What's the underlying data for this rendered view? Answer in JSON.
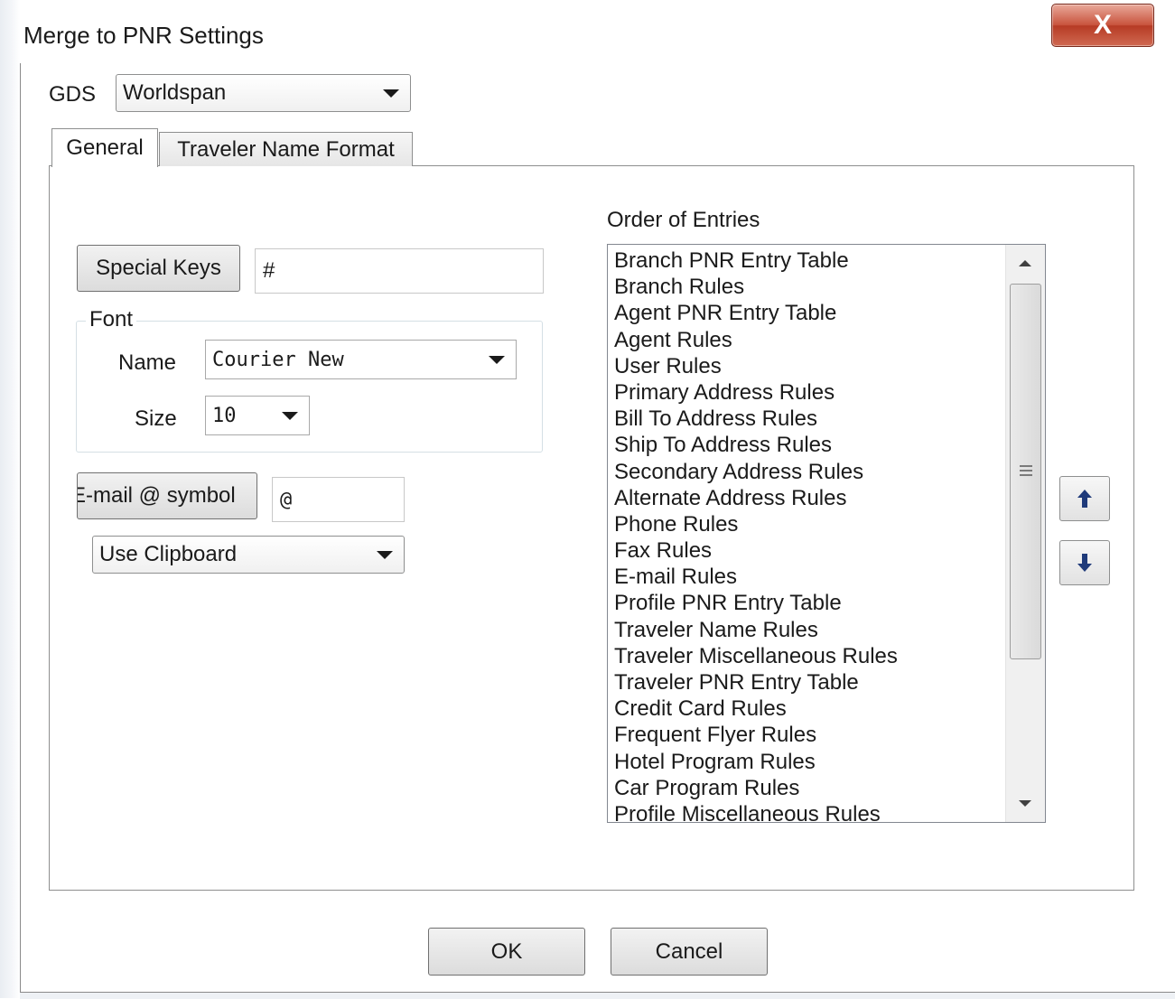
{
  "window": {
    "title": "Merge to PNR Settings",
    "close_label": "X"
  },
  "gds": {
    "label": "GDS",
    "selected": "Worldspan"
  },
  "tabs": [
    {
      "label": "General",
      "active": true
    },
    {
      "label": "Traveler Name Format",
      "active": false
    }
  ],
  "general": {
    "special_keys_button": "Special Keys",
    "special_keys_value": "#",
    "font_group_label": "Font",
    "font_name_label": "Name",
    "font_name_selected": "Courier New",
    "font_size_label": "Size",
    "font_size_selected": "10",
    "email_button": "E-mail @ symbol",
    "email_value": "@",
    "output_selected": "Use Clipboard"
  },
  "order": {
    "label": "Order of Entries",
    "items": [
      "Branch PNR Entry Table",
      "Branch Rules",
      "Agent PNR Entry Table",
      "Agent Rules",
      "User Rules",
      "Primary Address Rules",
      "Bill To Address Rules",
      "Ship To Address Rules",
      "Secondary Address Rules",
      "Alternate Address Rules",
      "Phone Rules",
      "Fax Rules",
      "E-mail Rules",
      "Profile PNR Entry Table",
      "Traveler Name Rules",
      "Traveler Miscellaneous Rules",
      "Traveler PNR Entry Table",
      "Credit Card Rules",
      "Frequent Flyer Rules",
      "Hotel Program Rules",
      "Car Program Rules",
      "Profile Miscellaneous Rules"
    ],
    "move_up_icon": "arrow-up-icon",
    "move_down_icon": "arrow-down-icon"
  },
  "footer": {
    "ok_label": "OK",
    "cancel_label": "Cancel"
  },
  "colors": {
    "close_button": "#c8523c",
    "arrow_icon": "#1f3a7a"
  }
}
